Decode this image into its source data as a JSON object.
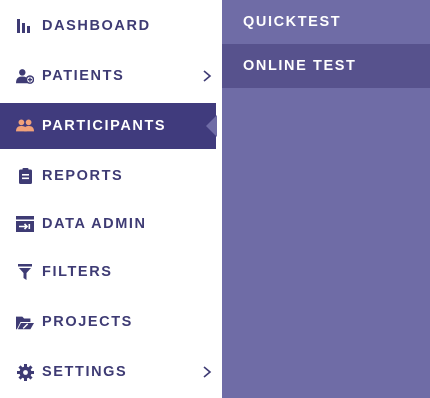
{
  "colors": {
    "nav_text": "#3e3b74",
    "active_bg": "#403b7d",
    "active_icon": "#f1a27a",
    "submenu_bg": "#6f6ca6",
    "submenu_selected_bg": "#57528d"
  },
  "sidebar": {
    "items": [
      {
        "label": "DASHBOARD",
        "icon": "bar-chart-icon"
      },
      {
        "label": "PATIENTS",
        "icon": "user-add-icon",
        "has_submenu": true
      },
      {
        "label": "PARTICIPANTS",
        "icon": "users-icon",
        "active": true
      },
      {
        "label": "REPORTS",
        "icon": "clipboard-icon"
      },
      {
        "label": "DATA ADMIN",
        "icon": "database-import-icon"
      },
      {
        "label": "FILTERS",
        "icon": "filter-icon"
      },
      {
        "label": "PROJECTS",
        "icon": "folder-icon"
      },
      {
        "label": "SETTINGS",
        "icon": "gear-icon",
        "has_submenu": true
      }
    ]
  },
  "submenu": {
    "items": [
      {
        "label": "QUICKTEST"
      },
      {
        "label": "ONLINE TEST",
        "selected": true
      }
    ]
  }
}
